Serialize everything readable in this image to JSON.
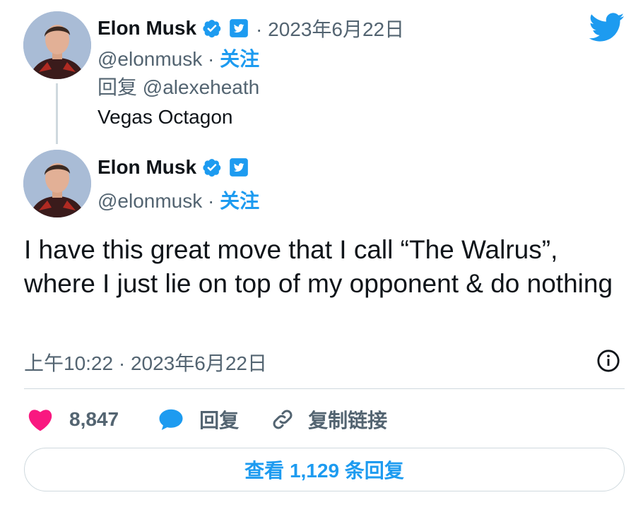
{
  "parent_tweet": {
    "name": "Elon Musk",
    "date": "· 2023年6月22日",
    "handle": "@elonmusk",
    "separator": " · ",
    "follow_label": "关注",
    "reply_to": "回复 @alexeheath",
    "text": "Vegas Octagon"
  },
  "main_tweet": {
    "name": "Elon Musk",
    "handle": "@elonmusk",
    "separator": " · ",
    "follow_label": "关注",
    "text": "I have this great move that I call “The Walrus”, where I just lie on top of my opponent & do nothing",
    "timestamp": "上午10:22 · 2023年6月22日"
  },
  "actions": {
    "like_count": "8,847",
    "reply_label": "回复",
    "copy_link_label": "复制链接"
  },
  "view_replies_label": "查看 1,129 条回复",
  "icons": {
    "verified": "verified-badge-icon",
    "twitter_badge": "twitter-affiliate-icon",
    "brand": "twitter-bird-icon",
    "like": "heart-icon",
    "reply": "speech-bubble-icon",
    "copy_link": "link-icon",
    "info": "info-icon"
  },
  "colors": {
    "accent": "#1d9bf0",
    "like": "#f91880",
    "text": "#0f1419",
    "secondary": "#536471",
    "border": "#cfd9de"
  }
}
